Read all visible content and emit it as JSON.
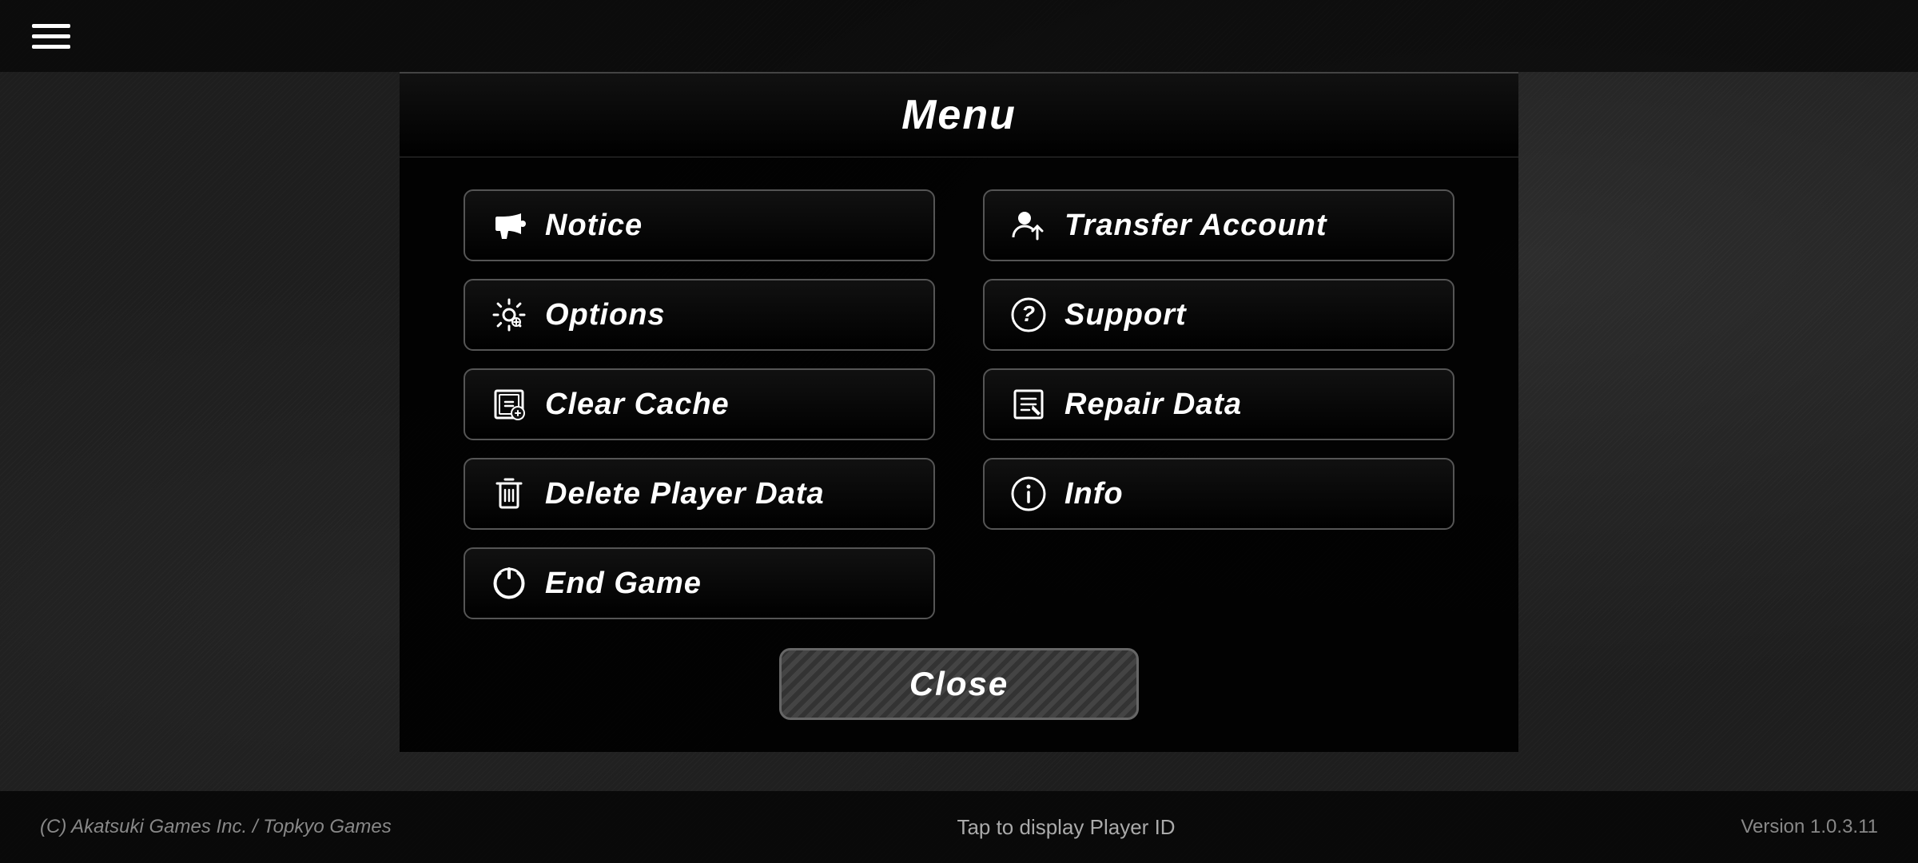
{
  "app": {
    "title": "Menu",
    "copyright": "(C) Akatsuki Games Inc. / Topkyo Games",
    "version": "Version 1.0.3.11",
    "player_id_tap": "Tap to display Player ID"
  },
  "menu": {
    "title": "Menu",
    "buttons": [
      {
        "id": "notice",
        "label": "Notice",
        "icon": "📣",
        "column": 1
      },
      {
        "id": "transfer-account",
        "label": "Transfer Account",
        "icon": "👤",
        "column": 2
      },
      {
        "id": "options",
        "label": "Options",
        "icon": "⚙",
        "column": 1
      },
      {
        "id": "support",
        "label": "Support",
        "icon": "❓",
        "column": 2
      },
      {
        "id": "clear-cache",
        "label": "Clear Cache",
        "icon": "🗂",
        "column": 1
      },
      {
        "id": "repair-data",
        "label": "Repair Data",
        "icon": "🗃",
        "column": 2
      },
      {
        "id": "delete-player-data",
        "label": "Delete Player Data",
        "icon": "🗑",
        "column": 1
      },
      {
        "id": "info",
        "label": "Info",
        "icon": "ℹ",
        "column": 2
      },
      {
        "id": "end-game",
        "label": "End Game",
        "icon": "⏻",
        "column": 1
      }
    ],
    "close_label": "Close"
  }
}
